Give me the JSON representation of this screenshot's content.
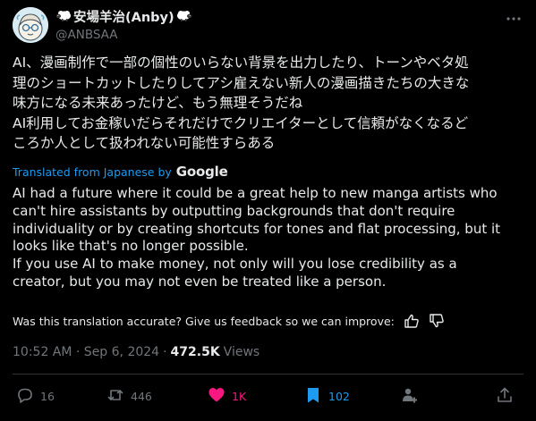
{
  "author": {
    "display_name": "安場羊治(Anby)",
    "handle": "@ANBSAA"
  },
  "tweet": {
    "original_text": "AI、漫画制作で一部の個性のいらない背景を出力したり、トーンやベタ処\n理のショートカットしたりしてアシ雇えない新人の漫画描きたちの大きな\n味方になる未来あったけど、もう無理そうだね\nAI利用してお金稼いだらそれだけでクリエイターとして信頼がなくなるど\nころか人として扱われない可能性すらある",
    "translated_label": "Translated from Japanese by",
    "translator": "Google",
    "translation": "AI had a future where it could be a great help to new manga artists who\ncan't hire assistants by outputting backgrounds that don't require\nindividuality or by creating shortcuts for tones and flat processing, but it\nlooks like that's no longer possible.\nIf you use AI to make money, not only will you lose credibility as a\ncreator, but you may not even be treated like a person.",
    "feedback_prompt": "Was this translation accurate? Give us feedback so we can improve:",
    "timestamp": "10:52 AM · Sep 6, 2024",
    "separator": "·",
    "views_count": "472.5K",
    "views_label": "Views"
  },
  "actions": {
    "replies": "16",
    "reposts": "446",
    "likes": "1K",
    "bookmarks": "102"
  },
  "colors": {
    "background": "#000000",
    "text": "#e7e9ea",
    "muted": "#71767b",
    "link": "#1d9bf0",
    "like": "#f91880",
    "bookmark": "#1d9bf0"
  },
  "icons": {
    "more": "more-dots-icon",
    "thumbs_up": "thumbs-up-icon",
    "thumbs_down": "thumbs-down-icon",
    "reply": "reply-icon",
    "repost": "repost-icon",
    "like": "heart-icon",
    "bookmark": "bookmark-icon",
    "grok": "grok-icon",
    "share": "share-icon",
    "badge": "sheep-emoji-icon"
  }
}
